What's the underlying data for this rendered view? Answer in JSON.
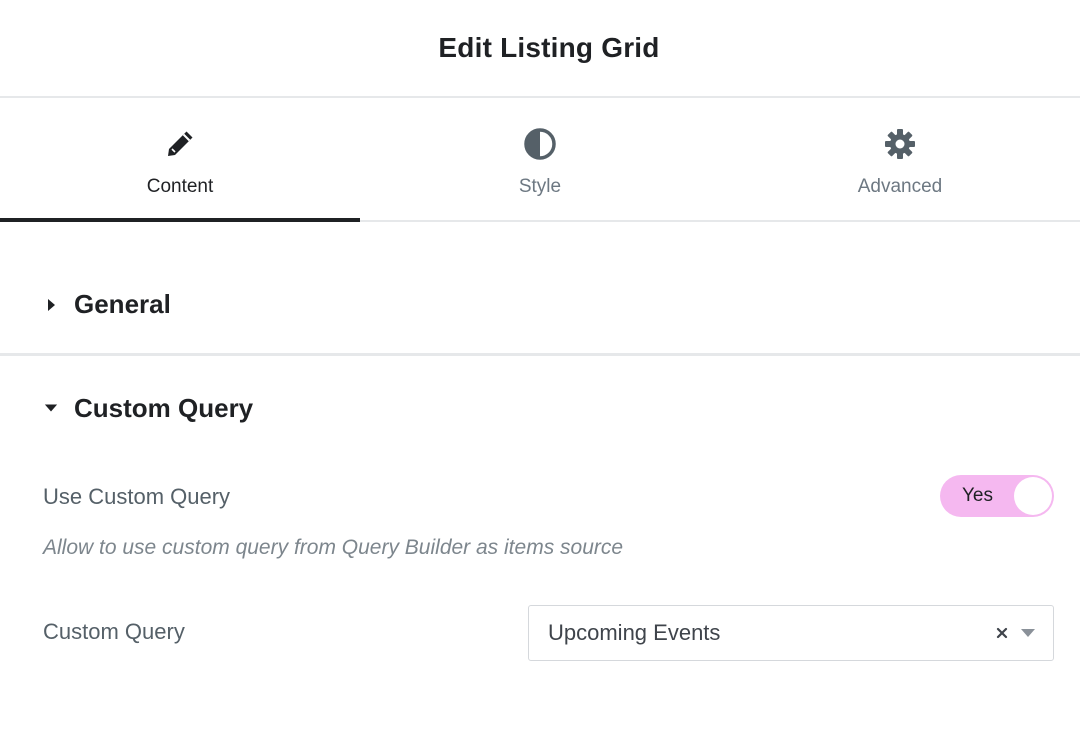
{
  "header": {
    "title": "Edit Listing Grid"
  },
  "tabs": [
    {
      "label": "Content",
      "icon": "pencil-icon",
      "active": true
    },
    {
      "label": "Style",
      "icon": "half-circle-icon",
      "active": false
    },
    {
      "label": "Advanced",
      "icon": "gear-icon",
      "active": false
    }
  ],
  "sections": {
    "general": {
      "title": "General",
      "expanded": false
    },
    "custom_query": {
      "title": "Custom Query",
      "expanded": true,
      "use_custom_query": {
        "label": "Use Custom Query",
        "toggle_text": "Yes",
        "enabled": true
      },
      "description": "Allow to use custom query from Query Builder as items source",
      "custom_query_select": {
        "label": "Custom Query",
        "value": "Upcoming Events"
      }
    }
  },
  "colors": {
    "toggle_on": "#f5b8f0",
    "active_tab_indicator": "#1f2124",
    "divider": "#e6e8ea"
  }
}
